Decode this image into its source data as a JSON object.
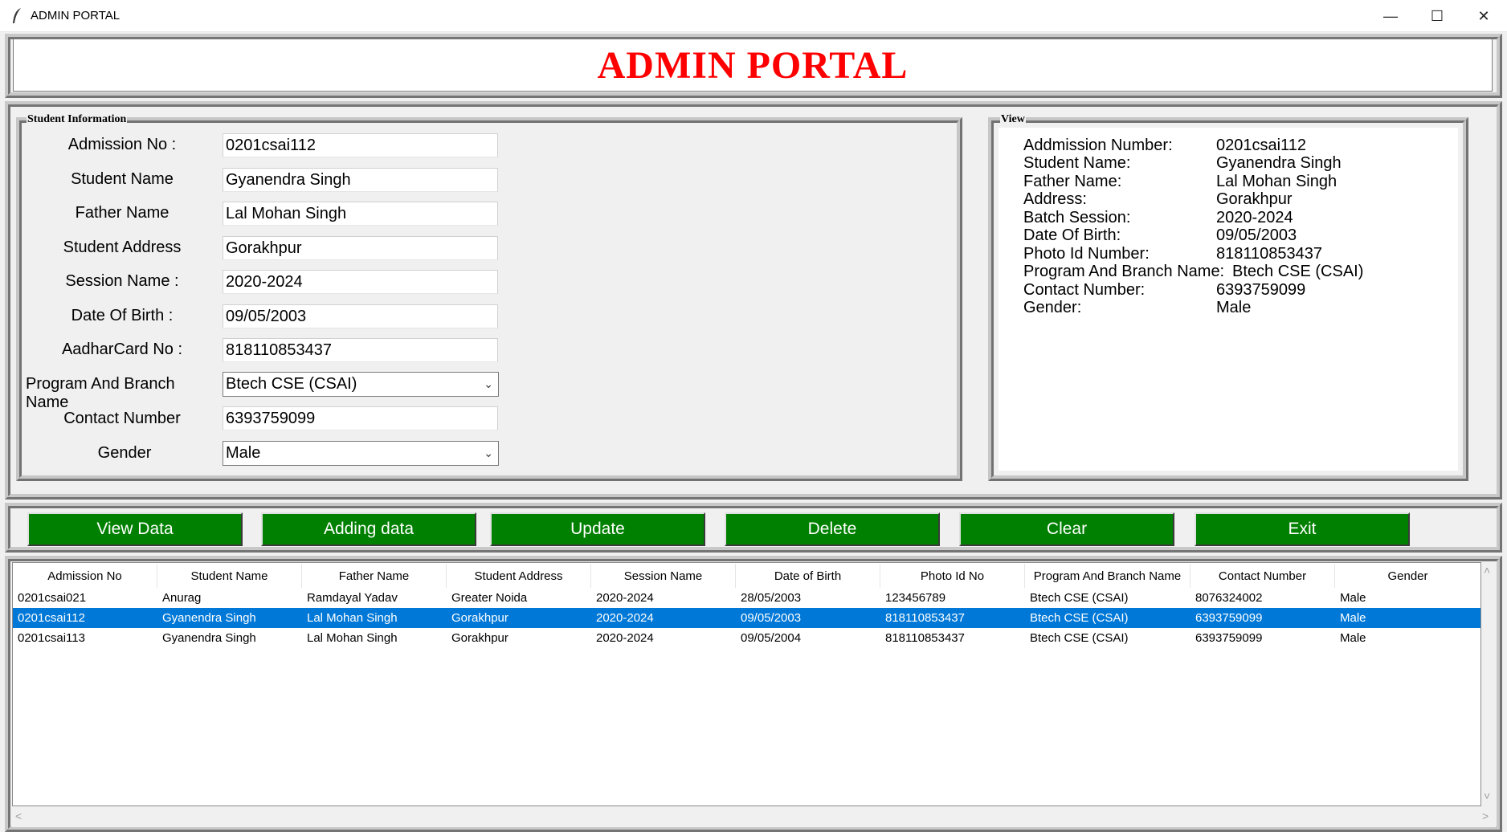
{
  "window": {
    "title": "ADMIN PORTAL",
    "minimize": "—",
    "maximize": "☐",
    "close": "✕"
  },
  "header": {
    "title": "ADMIN PORTAL"
  },
  "student_info": {
    "legend": "Student Information",
    "fields": [
      {
        "label": "Admission No :",
        "value": "0201csai112"
      },
      {
        "label": "Student Name",
        "value": "Gyanendra Singh"
      },
      {
        "label": "Father Name",
        "value": "Lal Mohan Singh"
      },
      {
        "label": "Student Address",
        "value": "Gorakhpur"
      },
      {
        "label": "Session Name :",
        "value": "2020-2024"
      },
      {
        "label": "Date Of Birth :",
        "value": "09/05/2003"
      },
      {
        "label": "AadharCard No :",
        "value": "818110853437"
      },
      {
        "label": "Program And Branch Name",
        "value": "Btech CSE (CSAI)"
      },
      {
        "label": "Contact Number",
        "value": "6393759099"
      },
      {
        "label": "Gender",
        "value": "Male"
      }
    ]
  },
  "view": {
    "legend": "View",
    "rows": [
      {
        "label": "Addmission Number:",
        "value": "0201csai112"
      },
      {
        "label": "Student Name:",
        "value": "Gyanendra Singh"
      },
      {
        "label": "Father Name:",
        "value": "Lal Mohan Singh"
      },
      {
        "label": "Address:",
        "value": "Gorakhpur"
      },
      {
        "label": "Batch Session:",
        "value": "2020-2024"
      },
      {
        "label": "Date Of Birth:",
        "value": "09/05/2003"
      },
      {
        "label": "Photo Id Number:",
        "value": "818110853437"
      },
      {
        "label": "Program And Branch Name:",
        "value": "Btech CSE (CSAI)"
      },
      {
        "label": "Contact Number:",
        "value": "6393759099"
      },
      {
        "label": "Gender:",
        "value": "Male"
      }
    ]
  },
  "buttons": {
    "view": "View Data",
    "add": "Adding data",
    "update": "Update",
    "delete": "Delete",
    "clear": "Clear",
    "exit": "Exit"
  },
  "table": {
    "columns": [
      "Admission No",
      "Student Name",
      "Father Name",
      "Student Address",
      "Session Name",
      "Date of Birth",
      "Photo Id No",
      "Program And Branch Name",
      "Contact Number",
      "Gender"
    ],
    "rows": [
      [
        "0201csai021",
        "Anurag",
        "Ramdayal Yadav",
        "Greater Noida",
        "2020-2024",
        "28/05/2003",
        "123456789",
        "Btech CSE (CSAI)",
        "8076324002",
        "Male"
      ],
      [
        "0201csai112",
        "Gyanendra Singh",
        "Lal Mohan Singh",
        "Gorakhpur",
        "2020-2024",
        "09/05/2003",
        "818110853437",
        "Btech CSE (CSAI)",
        "6393759099",
        "Male"
      ],
      [
        "0201csai113",
        "Gyanendra Singh",
        "Lal Mohan Singh",
        "Gorakhpur",
        "2020-2024",
        "09/05/2004",
        "818110853437",
        "Btech CSE (CSAI)",
        "6393759099",
        "Male"
      ]
    ],
    "selected_row": 1
  },
  "colors": {
    "title_red": "#ff0000",
    "button_green": "#008000",
    "selection_blue": "#0078d7"
  }
}
